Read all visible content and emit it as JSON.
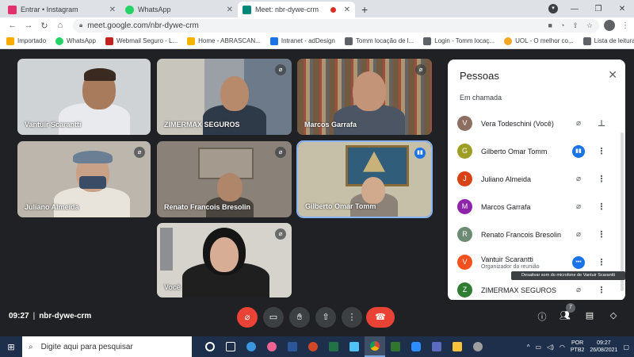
{
  "browser": {
    "tabs": [
      {
        "label": "Entrar • Instagram",
        "icon": "instagram-icon",
        "color": "#e1306c"
      },
      {
        "label": "WhatsApp",
        "icon": "whatsapp-icon",
        "color": "#25d366"
      },
      {
        "label": "Meet: nbr-dywe-crm",
        "icon": "meet-icon",
        "color": "#00897b"
      }
    ],
    "new_tab": "+",
    "url": "meet.google.com/nbr-dywe-crm"
  },
  "bookmarks": {
    "items": [
      {
        "label": "Importado",
        "icon": "folder-icon",
        "color": "#f9ab00"
      },
      {
        "label": "WhatsApp",
        "icon": "whatsapp-icon",
        "color": "#25d366"
      },
      {
        "label": "Webmail Seguro - L...",
        "icon": "webmail-icon",
        "color": "#c5221f"
      },
      {
        "label": "Home - ABRASCAN...",
        "icon": "abrascan-icon",
        "color": "#f4b400"
      },
      {
        "label": "Intranet - adDesign",
        "icon": "addesign-icon",
        "color": "#1a73e8"
      },
      {
        "label": "Tomm locação de l...",
        "icon": "tomm-icon",
        "color": "#5f6368"
      },
      {
        "label": "Login - Tomm locaç...",
        "icon": "tomm-icon",
        "color": "#5f6368"
      },
      {
        "label": "UOL - O melhor co...",
        "icon": "uol-icon",
        "color": "#f5a623"
      }
    ],
    "reading_list": "Lista de leitura"
  },
  "meeting": {
    "time": "09:27",
    "code": "nbr-dywe-crm",
    "tiles": [
      {
        "name": "Vantuir Scarantti",
        "muted": false,
        "speaking": false
      },
      {
        "name": "ZIMERMAX SEGUROS",
        "muted": true,
        "speaking": false
      },
      {
        "name": "Marcos Garrafa",
        "muted": true,
        "speaking": false
      },
      {
        "name": "Juliano Almeida",
        "muted": true,
        "speaking": false
      },
      {
        "name": "Renato Francois Bresolin",
        "muted": true,
        "speaking": false
      },
      {
        "name": "Gilberto Omar Tomm",
        "muted": false,
        "speaking": true
      },
      {
        "name": "Você",
        "muted": true,
        "speaking": false
      }
    ],
    "people_count": "7"
  },
  "people_panel": {
    "title": "Pessoas",
    "section": "Em chamada",
    "participants": [
      {
        "name": "Vera Todeschini (Você)",
        "sub": "",
        "avatar": "V",
        "color": "#8d6e63",
        "mic": "muted",
        "action": "pin"
      },
      {
        "name": "Gilberto Omar Tomm",
        "sub": "",
        "avatar": "G",
        "color": "#9e9d24",
        "mic": "speaking",
        "action": "more"
      },
      {
        "name": "Juliano Almeida",
        "sub": "",
        "avatar": "J",
        "color": "#d84315",
        "mic": "muted",
        "action": "more"
      },
      {
        "name": "Marcos Garrafa",
        "sub": "",
        "avatar": "M",
        "color": "#8e24aa",
        "mic": "muted",
        "action": "more"
      },
      {
        "name": "Renato Francois Bresolin",
        "sub": "",
        "avatar": "R",
        "color": "#6d8b74",
        "mic": "muted",
        "action": "more"
      },
      {
        "name": "Vantuir Scarantti",
        "sub": "Organizador da reunião",
        "avatar": "V",
        "color": "#f4511e",
        "mic": "active",
        "action": "more"
      },
      {
        "name": "ZIMERMAX SEGUROS",
        "sub": "",
        "avatar": "Z",
        "color": "#2e7d32",
        "mic": "muted",
        "action": "more"
      }
    ],
    "tooltip": "Desativar som do microfone de Vantuir Scarantti"
  },
  "taskbar": {
    "search_placeholder": "Digite aqui para pesquisar",
    "lang_line1": "POR",
    "lang_line2": "PTB2",
    "clock_time": "09:27",
    "clock_date": "26/08/2021"
  }
}
